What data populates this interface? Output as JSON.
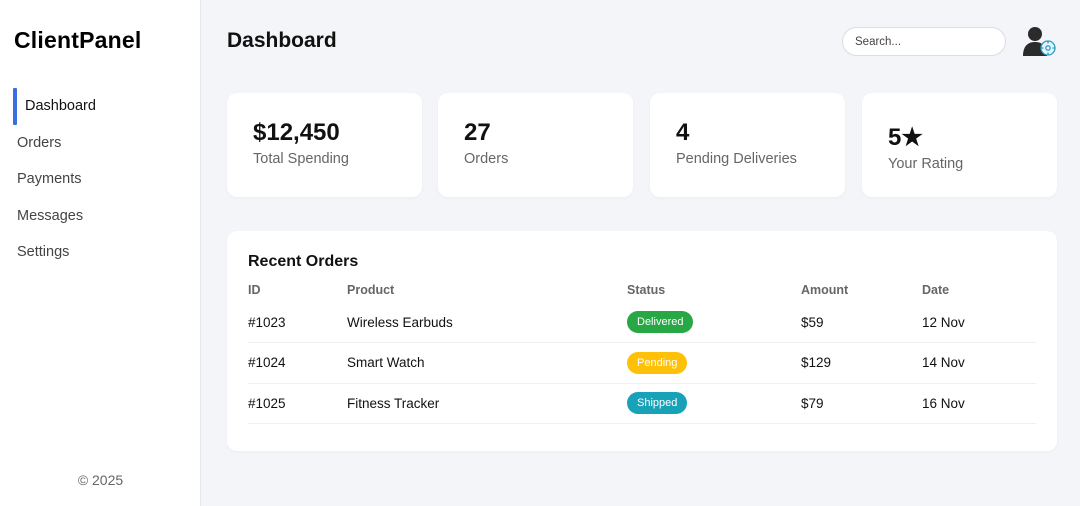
{
  "brand": "ClientPanel",
  "nav": [
    {
      "label": "Dashboard",
      "active": true
    },
    {
      "label": "Orders",
      "active": false
    },
    {
      "label": "Payments",
      "active": false
    },
    {
      "label": "Messages",
      "active": false
    },
    {
      "label": "Settings",
      "active": false
    }
  ],
  "footer": {
    "copyright": "© 2025"
  },
  "header": {
    "title": "Dashboard",
    "search_placeholder": "Search...",
    "avatar_icon": "user-avatar-icon"
  },
  "stats": [
    {
      "value": "$12,450",
      "label": "Total Spending"
    },
    {
      "value": "27",
      "label": "Orders"
    },
    {
      "value": "4",
      "label": "Pending Deliveries"
    },
    {
      "value": "5★",
      "label": "Your Rating"
    }
  ],
  "recent_orders": {
    "title": "Recent Orders",
    "columns": [
      "ID",
      "Product",
      "Status",
      "Amount",
      "Date"
    ],
    "rows": [
      {
        "id": "#1023",
        "product": "Wireless Earbuds",
        "status": "Delivered",
        "status_color": "#28a745",
        "amount": "$59",
        "date": "12 Nov"
      },
      {
        "id": "#1024",
        "product": "Smart Watch",
        "status": "Pending",
        "status_color": "#ffc107",
        "amount": "$129",
        "date": "14 Nov"
      },
      {
        "id": "#1025",
        "product": "Fitness Tracker",
        "status": "Shipped",
        "status_color": "#17a2b8",
        "amount": "$79",
        "date": "16 Nov"
      }
    ]
  },
  "colors": {
    "accent": "#3b6fe0",
    "background": "#f4f5f9"
  }
}
